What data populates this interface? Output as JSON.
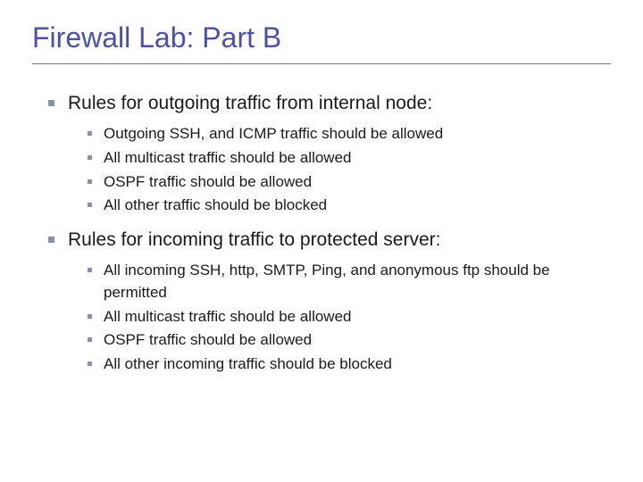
{
  "title": "Firewall Lab: Part B",
  "sections": [
    {
      "heading": "Rules for outgoing traffic from internal node:",
      "items": [
        "Outgoing SSH, and ICMP traffic should be allowed",
        "All multicast traffic should be allowed",
        "OSPF traffic should be allowed",
        "All other traffic should be blocked"
      ]
    },
    {
      "heading": "Rules for incoming traffic to protected server:",
      "items": [
        "All incoming SSH, http, SMTP, Ping, and anonymous ftp should be permitted",
        "All multicast traffic should be allowed",
        "OSPF traffic should be allowed",
        "All other incoming traffic should be blocked"
      ]
    }
  ]
}
